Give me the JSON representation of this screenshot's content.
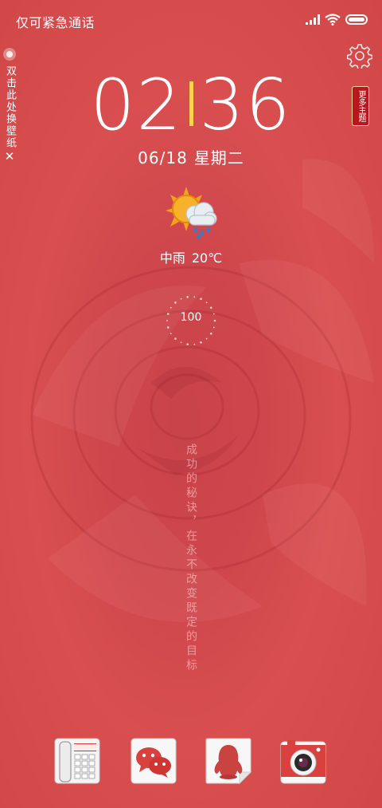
{
  "status_bar": {
    "carrier": "仅可紧急通话",
    "signal_icon": "signal-icon",
    "wifi_icon": "wifi-icon",
    "battery_icon": "battery-icon"
  },
  "wallpaper_hint": {
    "text": "双击此处换壁纸",
    "close": "✕"
  },
  "more_themes": "更多主题",
  "clock": {
    "hours": "02",
    "minutes": "36"
  },
  "date": {
    "day": "06/18",
    "weekday": "星期二"
  },
  "weather": {
    "condition": "中雨",
    "temperature": "20℃",
    "icon": "sun-cloud-rain-icon"
  },
  "counter": {
    "value": "100"
  },
  "motto": "成功的秘诀，在永不改变既定的目标",
  "dock": [
    {
      "name": "phone",
      "icon": "phone-icon"
    },
    {
      "name": "wechat",
      "icon": "wechat-icon"
    },
    {
      "name": "qq",
      "icon": "qq-penguin-icon"
    },
    {
      "name": "camera",
      "icon": "camera-icon"
    }
  ],
  "colors": {
    "background": "#d14848",
    "accent": "#ffd24a",
    "theme_badge": "#b8181d"
  }
}
